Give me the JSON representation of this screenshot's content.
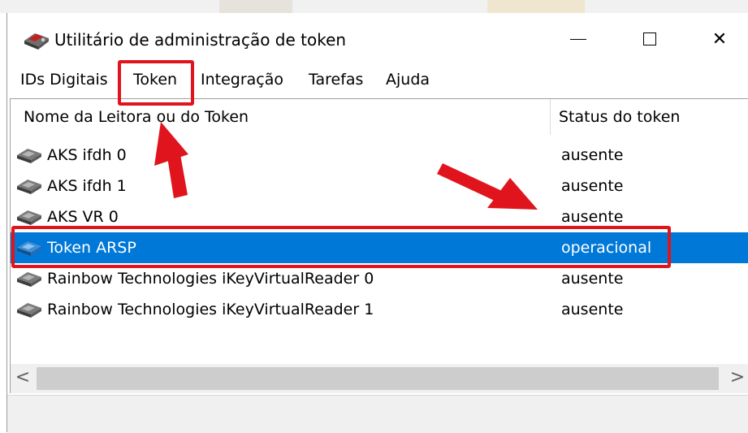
{
  "window": {
    "title": "Utilitário de administração de token",
    "controls": {
      "minimize": "minimize-icon",
      "maximize": "maximize-icon",
      "close": "close-icon",
      "close_glyph": "✕"
    }
  },
  "menu": {
    "items": [
      {
        "label": "IDs Digitais"
      },
      {
        "label": "Token"
      },
      {
        "label": "Integração"
      },
      {
        "label": "Tarefas"
      },
      {
        "label": "Ajuda"
      }
    ]
  },
  "list": {
    "columns": {
      "name": "Nome da Leitora ou do Token",
      "status": "Status do token"
    },
    "rows": [
      {
        "name": "AKS ifdh 0",
        "status": "ausente",
        "selected": false,
        "icon": "reader-icon"
      },
      {
        "name": "AKS ifdh 1",
        "status": "ausente",
        "selected": false,
        "icon": "reader-icon"
      },
      {
        "name": "AKS VR 0",
        "status": "ausente",
        "selected": false,
        "icon": "reader-icon"
      },
      {
        "name": "Token ARSP",
        "status": "operacional",
        "selected": true,
        "icon": "token-icon"
      },
      {
        "name": "Rainbow Technologies iKeyVirtualReader 0",
        "status": "ausente",
        "selected": false,
        "icon": "reader-icon"
      },
      {
        "name": "Rainbow Technologies iKeyVirtualReader 1",
        "status": "ausente",
        "selected": false,
        "icon": "reader-icon"
      }
    ]
  },
  "scrollbar": {
    "left_arrow": "<",
    "right_arrow": ">"
  },
  "colors": {
    "selection": "#0078d7",
    "annotation": "#e0141c"
  }
}
